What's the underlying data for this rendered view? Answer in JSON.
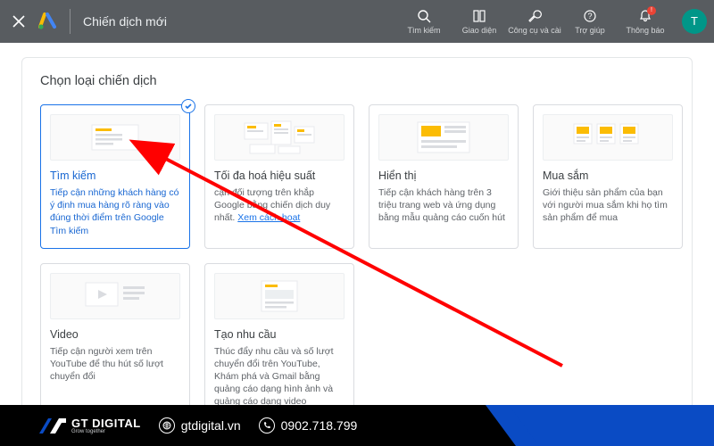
{
  "header": {
    "title": "Chiến dịch mới",
    "nav": {
      "search": "Tìm kiếm",
      "appearance": "Giao diện",
      "tools": "Công cụ và cài",
      "help": "Trợ giúp",
      "notifications": "Thông báo"
    },
    "avatar_initial": "T"
  },
  "section_title": "Chọn loại chiến dịch",
  "options": [
    {
      "title": "Tìm kiếm",
      "desc": "Tiếp cận những khách hàng có ý định mua hàng rõ ràng vào đúng thời điểm trên Google Tìm kiếm",
      "selected": true
    },
    {
      "title": "Tối đa hoá hiệu suất",
      "desc": "cận đối tượng trên khắp Google bằng    chiến dịch duy nhất. ",
      "link": "Xem cách hoạt"
    },
    {
      "title": "Hiển thị",
      "desc": "Tiếp cận khách hàng trên 3 triệu trang web và ứng dụng bằng mẫu quảng cáo cuốn hút"
    },
    {
      "title": "Mua sắm",
      "desc": "Giới thiệu sản phẩm của bạn với người mua sắm khi họ tìm sản phẩm để mua"
    },
    {
      "title": "Video",
      "desc": "Tiếp cận người xem trên YouTube để thu hút số lượt chuyển đổi"
    },
    {
      "title": "Tạo nhu cầu",
      "desc": "Thúc đẩy nhu cầu và số lượt chuyển đổi trên YouTube, Khám phá và Gmail bằng quảng cáo dạng hình ảnh và quảng cáo dạng video"
    }
  ],
  "footer": {
    "brand_name": "GT DIGITAL",
    "brand_tag": "Grow together",
    "website": "gtdigital.vn",
    "phone": "0902.718.799"
  }
}
